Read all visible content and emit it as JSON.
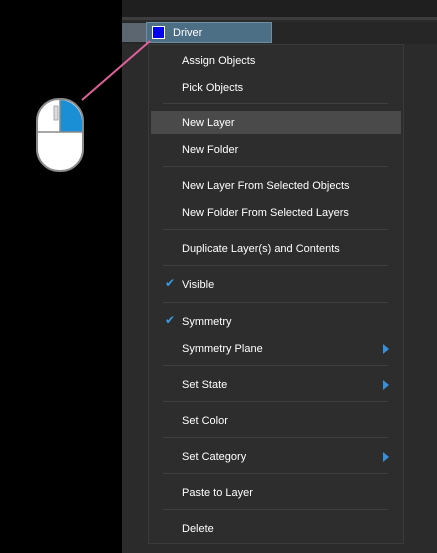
{
  "layer": {
    "name": "Driver",
    "swatch_color": "#0000ee"
  },
  "menu": {
    "items": [
      {
        "label": "Assign Objects"
      },
      {
        "label": "Pick Objects"
      },
      {
        "label": "New Layer",
        "highlighted": true
      },
      {
        "label": "New Folder"
      },
      {
        "label": "New Layer From Selected Objects"
      },
      {
        "label": "New Folder From Selected Layers"
      },
      {
        "label": "Duplicate Layer(s) and Contents"
      },
      {
        "label": "Visible",
        "checked": true
      },
      {
        "label": "Symmetry",
        "checked": true
      },
      {
        "label": "Symmetry Plane",
        "submenu": true
      },
      {
        "label": "Set State",
        "submenu": true
      },
      {
        "label": "Set Color"
      },
      {
        "label": "Set Category",
        "submenu": true
      },
      {
        "label": "Paste to Layer"
      },
      {
        "label": "Delete"
      }
    ]
  },
  "colors": {
    "accent": "#3b9bdf",
    "mouse_button": "#1a8fd6",
    "pointer_line": "#e0609a"
  },
  "icons": {
    "mouse": "mouse-right-click-icon",
    "check": "checkmark-icon",
    "submenu": "chevron-right-icon"
  }
}
